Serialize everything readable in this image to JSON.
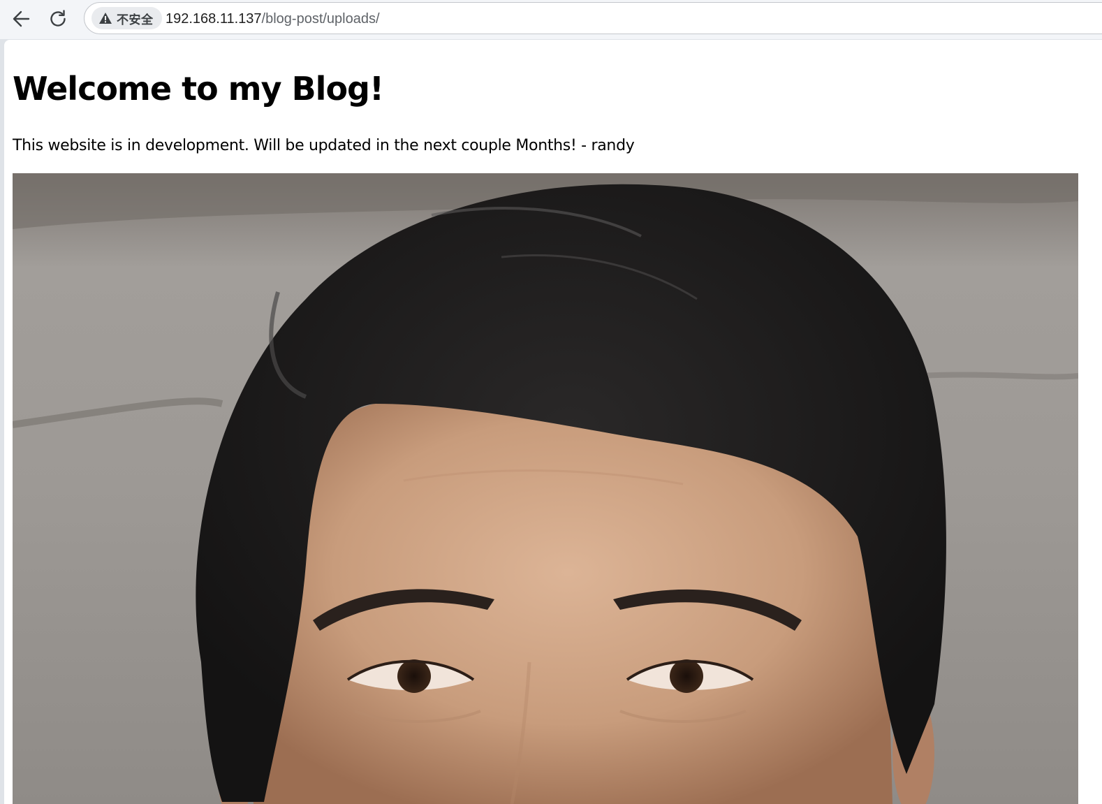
{
  "browser": {
    "security_label": "不安全",
    "url_host": "192.168.11.137",
    "url_path": "/blog-post/uploads/",
    "icons": {
      "back": "arrow-left-icon",
      "reload": "reload-icon",
      "security": "warning-triangle-icon"
    }
  },
  "page": {
    "heading": "Welcome to my Blog!",
    "paragraph": "This website is in development. Will be updated in the next couple Months! - randy",
    "image": {
      "description_name": "portrait-photo",
      "colors": {
        "background": "#9c9894",
        "hair": "#1b1a1a",
        "skin": "#caa184"
      }
    }
  }
}
